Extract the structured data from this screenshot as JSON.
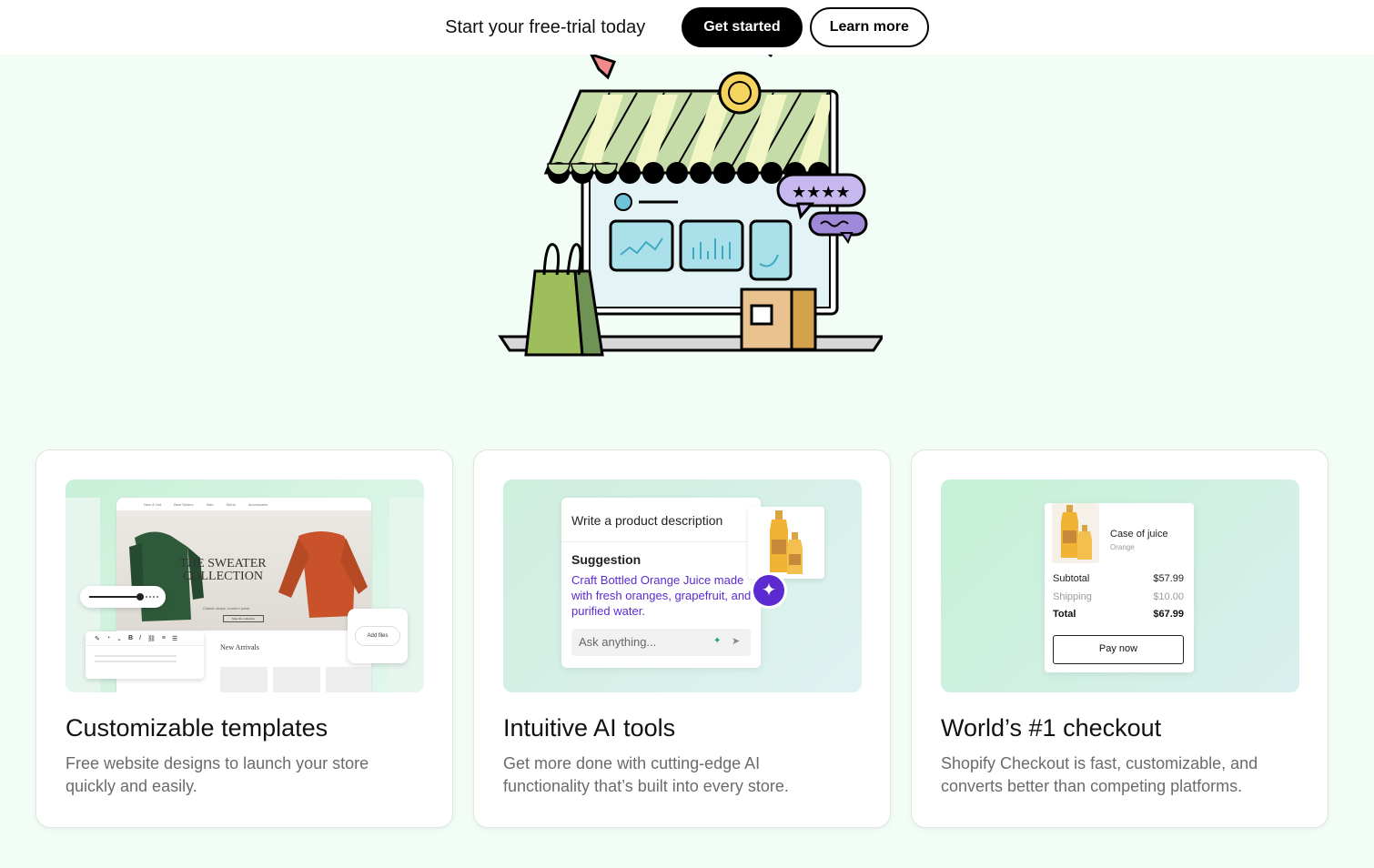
{
  "promo": {
    "text": "Start your free-trial today",
    "get_started": "Get started",
    "learn_more": "Learn more"
  },
  "colors": {
    "page_bg": "#f2fdf6",
    "accent_purple": "#5b2bd1",
    "primary_button": "#000000"
  },
  "cards": [
    {
      "title": "Customizable templates",
      "description": "Free website designs to launch your store quickly and easily.",
      "mockup": {
        "hero_title": "THE SWEATER COLLECTION",
        "hero_sub": "Classic shape, modern poise",
        "hero_button": "Shop the collection",
        "nav": [
          "New & Hot",
          "Best Sellers",
          "Sale",
          "Shirts",
          "Accessories"
        ],
        "section": "New Arrivals",
        "upload": "Add files"
      }
    },
    {
      "title": "Intuitive AI tools",
      "description": "Get more done with cutting-edge AI functionality that’s built into every store.",
      "mockup": {
        "heading": "Write a product description",
        "suggestion_label": "Suggestion",
        "suggestion_text": "Craft Bottled Orange Juice made with fresh oranges, grapefruit, and purified water.",
        "ask_placeholder": "Ask anything..."
      }
    },
    {
      "title": "World’s #1 checkout",
      "description": "Shopify Checkout is fast, customizable, and converts better than competing platforms.",
      "mockup": {
        "product_name": "Case of juice",
        "variant": "Orange",
        "subtotal_label": "Subtotal",
        "subtotal": "$57.99",
        "shipping_label": "Shipping",
        "shipping": "$10.00",
        "total_label": "Total",
        "total": "$67.99",
        "pay_button": "Pay now"
      }
    }
  ]
}
